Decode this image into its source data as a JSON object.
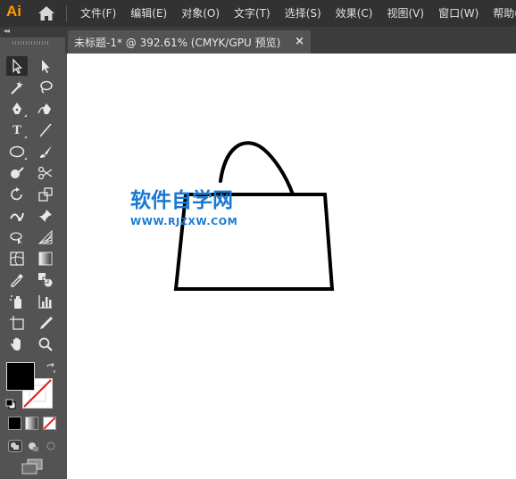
{
  "app": {
    "logo": "Ai"
  },
  "menu": {
    "items": [
      {
        "label": "文件(F)"
      },
      {
        "label": "编辑(E)"
      },
      {
        "label": "对象(O)"
      },
      {
        "label": "文字(T)"
      },
      {
        "label": "选择(S)"
      },
      {
        "label": "效果(C)"
      },
      {
        "label": "视图(V)"
      },
      {
        "label": "窗口(W)"
      },
      {
        "label": "帮助(H)"
      }
    ]
  },
  "document": {
    "tab_title": "未标题-1* @ 392.61% (CMYK/GPU 预览)",
    "close_glyph": "×"
  },
  "tools": {
    "type_glyph": "T",
    "fill_color": "#000000",
    "stroke_color": "none"
  },
  "artwork": {
    "shape": "handbag-outline",
    "stroke_color": "#000000"
  },
  "watermark": {
    "title": "软件自学网",
    "url": "WWW.RJZXW.COM",
    "color": "#1a78d2"
  }
}
